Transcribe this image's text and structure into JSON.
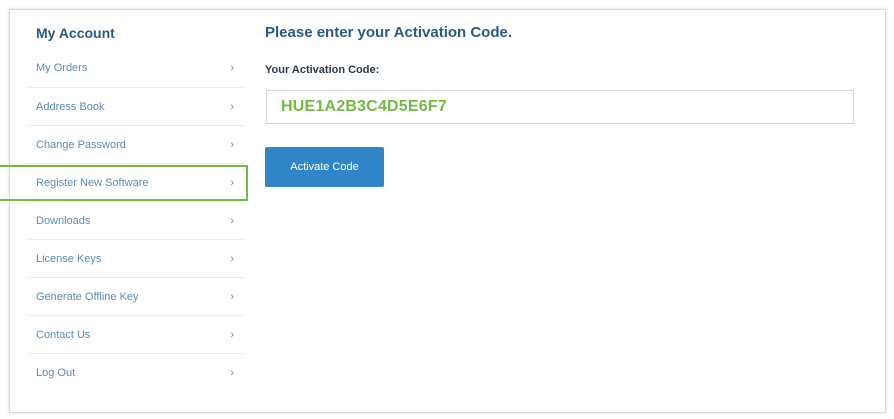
{
  "sidebar": {
    "title": "My Account",
    "items": [
      {
        "label": "My Orders",
        "chevron": "›"
      },
      {
        "label": "Address Book",
        "chevron": "›"
      },
      {
        "label": "Change Password",
        "chevron": "›"
      },
      {
        "label": "Register New Software",
        "chevron": "›"
      },
      {
        "label": "Downloads",
        "chevron": "›"
      },
      {
        "label": "License Keys",
        "chevron": "›"
      },
      {
        "label": "Generate Offline Key",
        "chevron": "›"
      },
      {
        "label": "Contact Us",
        "chevron": "›"
      },
      {
        "label": "Log Out",
        "chevron": "›"
      }
    ],
    "highlighted_item": "Register New Software"
  },
  "main": {
    "heading": "Please enter your Activation Code.",
    "field_label": "Your Activation Code:",
    "activation_code": "HUE1A2B3C4D5E6F7",
    "activate_button_label": "Activate Code"
  },
  "colors": {
    "heading": "#2a5a85",
    "link": "#5a8bb5",
    "accent_green": "#74b944",
    "button": "#2e86c9"
  }
}
